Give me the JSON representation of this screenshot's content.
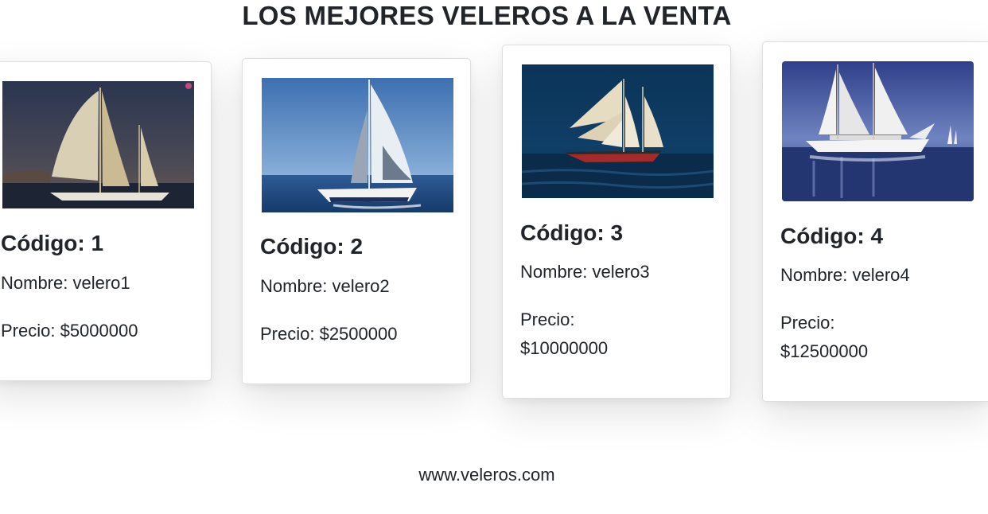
{
  "header": {
    "title": "LOS MEJORES VELEROS A LA VENTA"
  },
  "cards": [
    {
      "image": "sailboat-photo-sunset",
      "codigo": "Código: 1",
      "nombre": "Nombre: velero1",
      "precio_label": "Precio:",
      "precio_value": "$5000000",
      "precio_full": "Precio: $5000000"
    },
    {
      "image": "sailboat-photo-blue-sea",
      "codigo": "Código: 2",
      "nombre": "Nombre: velero2",
      "precio_label": "Precio:",
      "precio_value": "$2500000",
      "precio_full": "Precio: $2500000"
    },
    {
      "image": "schooner-photo-night",
      "codigo": "Código: 3",
      "nombre": "Nombre: velero3",
      "precio_label": "Precio:",
      "precio_value": "$10000000"
    },
    {
      "image": "schooner-photo-white",
      "codigo": "Código: 4",
      "nombre": "Nombre: velero4",
      "precio_label": "Precio:",
      "precio_value": "$12500000"
    }
  ],
  "footer": {
    "text": "www.veleros.com"
  },
  "colors": {
    "text": "#212529",
    "card_border": "#dcdcdc",
    "background": "#ffffff"
  }
}
